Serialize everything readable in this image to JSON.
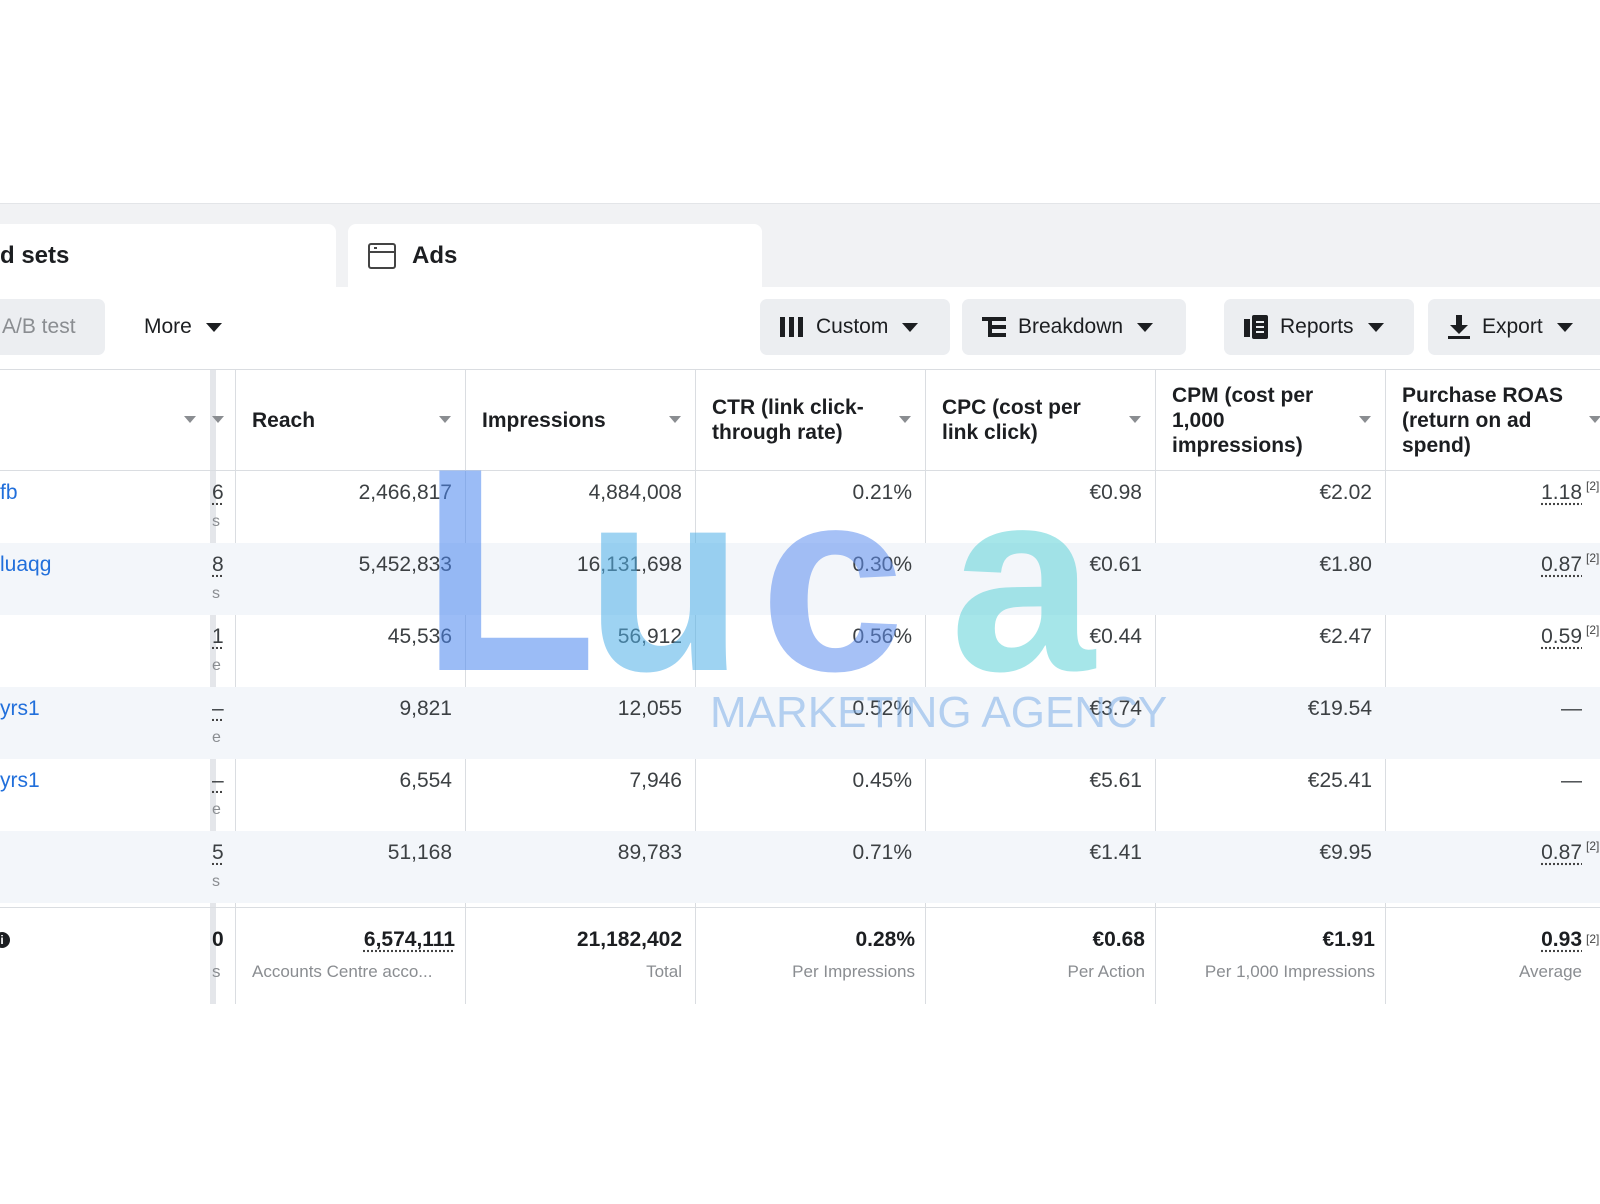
{
  "tabs": {
    "adsets_label": "d sets",
    "ads_label": "Ads"
  },
  "toolbar": {
    "abtest_label": "A/B test",
    "more_label": "More",
    "custom_label": "Custom",
    "breakdown_label": "Breakdown",
    "reports_label": "Reports",
    "export_label": "Export"
  },
  "columns": {
    "reach": "Reach",
    "impressions": "Impressions",
    "ctr": "CTR (link click-through rate)",
    "cpc": "CPC (cost per link click)",
    "cpm": "CPM (cost per 1,000 impressions)",
    "roas": "Purchase ROAS (return on ad spend)"
  },
  "rows": [
    {
      "name": "fb",
      "prev": "6",
      "prev_sub": "s",
      "reach": "2,466,817",
      "impressions": "4,884,008",
      "ctr": "0.21%",
      "cpc": "€0.98",
      "cpm": "€2.02",
      "roas": "1.18",
      "roas_note": "[2]"
    },
    {
      "name": "luaqg",
      "prev": "8",
      "prev_sub": "s",
      "reach": "5,452,833",
      "impressions": "16,131,698",
      "ctr": "0.30%",
      "cpc": "€0.61",
      "cpm": "€1.80",
      "roas": "0.87",
      "roas_note": "[2]"
    },
    {
      "name": "",
      "prev": "1",
      "prev_sub": "e",
      "reach": "45,536",
      "impressions": "56,912",
      "ctr": "0.56%",
      "cpc": "€0.44",
      "cpm": "€2.47",
      "roas": "0.59",
      "roas_note": "[2]"
    },
    {
      "name": "yrs1",
      "prev": "–",
      "prev_sub": "e",
      "reach": "9,821",
      "impressions": "12,055",
      "ctr": "0.52%",
      "cpc": "€3.74",
      "cpm": "€19.54",
      "roas": "—",
      "roas_note": ""
    },
    {
      "name": "yrs1",
      "prev": "–",
      "prev_sub": "e",
      "reach": "6,554",
      "impressions": "7,946",
      "ctr": "0.45%",
      "cpc": "€5.61",
      "cpm": "€25.41",
      "roas": "—",
      "roas_note": ""
    },
    {
      "name": "",
      "prev": "5",
      "prev_sub": "s",
      "reach": "51,168",
      "impressions": "89,783",
      "ctr": "0.71%",
      "cpc": "€1.41",
      "cpm": "€9.95",
      "roas": "0.87",
      "roas_note": "[2]"
    }
  ],
  "totals": {
    "prev": "0",
    "prev_sub": "s",
    "reach": "6,574,111",
    "reach_label": "Accounts Centre acco...",
    "impressions": "21,182,402",
    "impressions_label": "Total",
    "ctr": "0.28%",
    "ctr_label": "Per Impressions",
    "cpc": "€0.68",
    "cpc_label": "Per Action",
    "cpm": "€1.91",
    "cpm_label": "Per 1,000 Impressions",
    "roas": "0.93",
    "roas_label": "Average",
    "roas_note": "[2]"
  },
  "watermark": {
    "word": "Luca",
    "tagline": "MARKETING AGENCY",
    "colors": {
      "l": "#4a86f0",
      "u": "#4fb0e8",
      "c": "#5f8ff0",
      "a": "#5fd2d8",
      "tagline": "#7fb0e8"
    }
  }
}
